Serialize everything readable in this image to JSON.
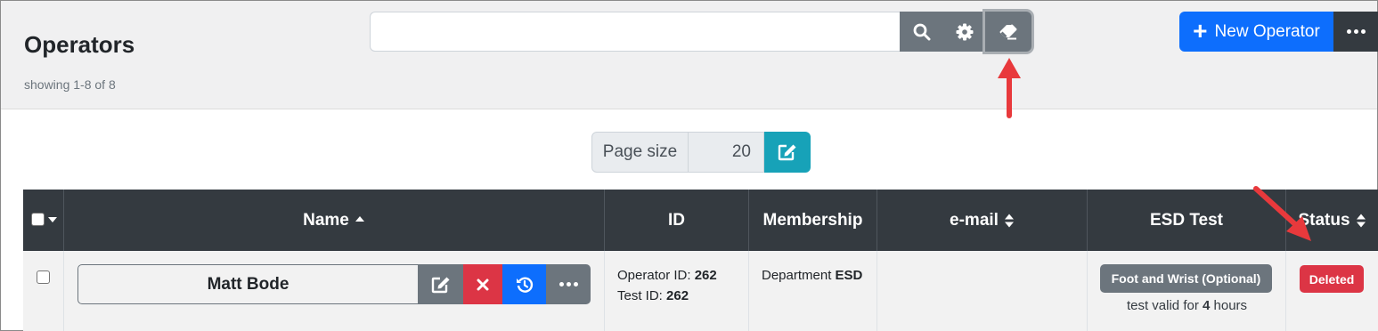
{
  "header": {
    "title": "Operators",
    "showing": "showing 1-8 of 8"
  },
  "search": {
    "value": "",
    "search_icon": "search-icon",
    "settings_icon": "gear-icon",
    "clear_icon": "eraser-icon"
  },
  "toolbar": {
    "new_operator_plus": "+",
    "new_operator_label": "New Operator",
    "more_icon": "ellipsis-icon"
  },
  "pagesize": {
    "label": "Page size",
    "value": "20"
  },
  "table": {
    "columns": [
      "Name",
      "ID",
      "Membership",
      "e-mail",
      "ESD Test",
      "Status"
    ],
    "rows": [
      {
        "name": "Matt Bode",
        "operator_id_label": "Operator ID:",
        "operator_id": "262",
        "test_id_label": "Test ID:",
        "test_id": "262",
        "membership_label": "Department",
        "membership": "ESD",
        "email": "",
        "esd_test": "Foot and Wrist (Optional)",
        "validity_prefix": "test valid for",
        "validity_value": "4",
        "validity_suffix": "hours",
        "status": "Deleted"
      }
    ]
  },
  "colors": {
    "primary": "#0d6efd",
    "danger": "#dc3545",
    "secondary": "#6c757d",
    "dark": "#343a40",
    "info": "#17a2b8",
    "annotation_arrow": "#e8393c"
  }
}
